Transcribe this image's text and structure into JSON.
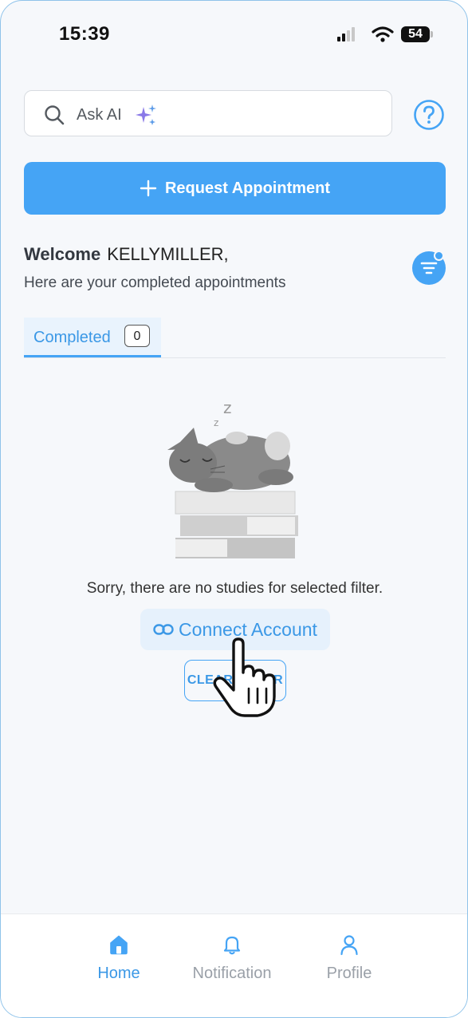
{
  "status_bar": {
    "time": "15:39",
    "battery": "54"
  },
  "search": {
    "placeholder": "Ask AI"
  },
  "header": {
    "request_button": "Request Appointment"
  },
  "welcome": {
    "greeting": "Welcome",
    "name": "KELLYMILLER,",
    "subtitle": "Here are your completed appointments"
  },
  "tabs": [
    {
      "label": "Completed",
      "count": "0"
    }
  ],
  "empty_state": {
    "message": "Sorry, there are no studies for selected filter.",
    "connect_button": "Connect Account",
    "clear_button": "CLEAR FILTER"
  },
  "bottom_nav": [
    {
      "label": "Home",
      "icon": "home-icon",
      "active": true
    },
    {
      "label": "Notification",
      "icon": "bell-icon",
      "active": false
    },
    {
      "label": "Profile",
      "icon": "user-icon",
      "active": false
    }
  ],
  "colors": {
    "accent": "#45a4f5",
    "background": "#f6f8fb",
    "inactive": "#9aa0a8"
  }
}
